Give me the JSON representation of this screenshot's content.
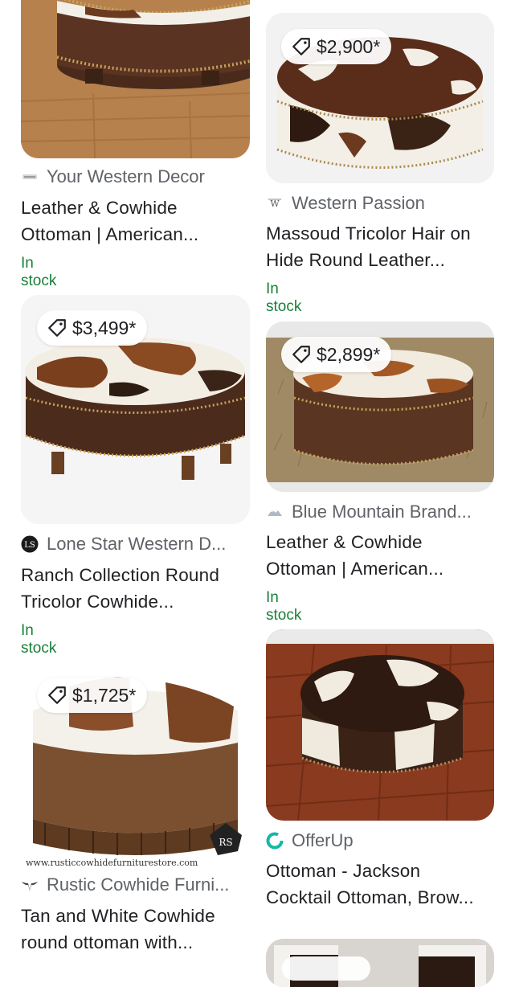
{
  "left_column": [
    {
      "price": "",
      "source": "Your Western Decor",
      "title_lines": [
        "Leather & Cowhide",
        "Ottoman | American..."
      ],
      "stock": "In stock"
    },
    {
      "price": "$3,499*",
      "source": "Lone Star Western D...",
      "title_lines": [
        "Ranch Collection Round",
        "Tricolor Cowhide..."
      ],
      "stock": "In stock"
    },
    {
      "price": "$1,725*",
      "source": "Rustic Cowhide Furni...",
      "title_lines": [
        "Tan and White Cowhide",
        "round ottoman with..."
      ],
      "stock": "",
      "watermark": "www.rusticcowhidefurniturestore.com"
    }
  ],
  "right_column": [
    {
      "price": "$2,900*",
      "source": "Western Passion",
      "title_lines": [
        "Massoud Tricolor Hair on",
        "Hide Round Leather..."
      ],
      "stock": "In stock"
    },
    {
      "price": "$2,899*",
      "source": "Blue Mountain Brand...",
      "title_lines": [
        "Leather & Cowhide",
        "Ottoman | American..."
      ],
      "stock": "In stock"
    },
    {
      "price": "",
      "source": "OfferUp",
      "title_lines": [
        "Ottoman - Jackson",
        "Cocktail Ottoman, Brow..."
      ],
      "stock": ""
    }
  ],
  "colors": {
    "stock_green": "#188038",
    "source_gray": "#5f6368",
    "offerup_teal": "#14b8a6"
  }
}
